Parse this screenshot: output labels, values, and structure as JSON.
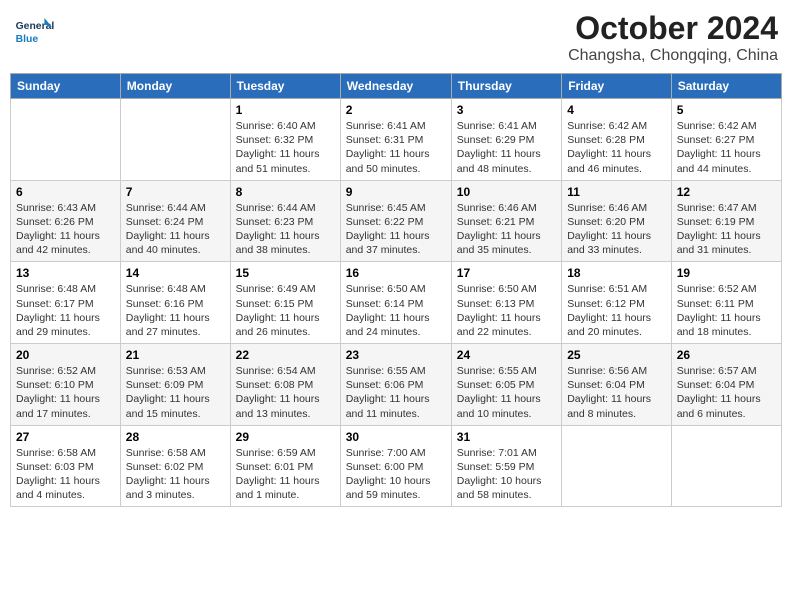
{
  "header": {
    "logo_general": "General",
    "logo_blue": "Blue",
    "title": "October 2024",
    "subtitle": "Changsha, Chongqing, China"
  },
  "calendar": {
    "days_of_week": [
      "Sunday",
      "Monday",
      "Tuesday",
      "Wednesday",
      "Thursday",
      "Friday",
      "Saturday"
    ],
    "weeks": [
      [
        {
          "day": "",
          "sunrise": "",
          "sunset": "",
          "daylight": ""
        },
        {
          "day": "",
          "sunrise": "",
          "sunset": "",
          "daylight": ""
        },
        {
          "day": "1",
          "sunrise": "Sunrise: 6:40 AM",
          "sunset": "Sunset: 6:32 PM",
          "daylight": "Daylight: 11 hours and 51 minutes."
        },
        {
          "day": "2",
          "sunrise": "Sunrise: 6:41 AM",
          "sunset": "Sunset: 6:31 PM",
          "daylight": "Daylight: 11 hours and 50 minutes."
        },
        {
          "day": "3",
          "sunrise": "Sunrise: 6:41 AM",
          "sunset": "Sunset: 6:29 PM",
          "daylight": "Daylight: 11 hours and 48 minutes."
        },
        {
          "day": "4",
          "sunrise": "Sunrise: 6:42 AM",
          "sunset": "Sunset: 6:28 PM",
          "daylight": "Daylight: 11 hours and 46 minutes."
        },
        {
          "day": "5",
          "sunrise": "Sunrise: 6:42 AM",
          "sunset": "Sunset: 6:27 PM",
          "daylight": "Daylight: 11 hours and 44 minutes."
        }
      ],
      [
        {
          "day": "6",
          "sunrise": "Sunrise: 6:43 AM",
          "sunset": "Sunset: 6:26 PM",
          "daylight": "Daylight: 11 hours and 42 minutes."
        },
        {
          "day": "7",
          "sunrise": "Sunrise: 6:44 AM",
          "sunset": "Sunset: 6:24 PM",
          "daylight": "Daylight: 11 hours and 40 minutes."
        },
        {
          "day": "8",
          "sunrise": "Sunrise: 6:44 AM",
          "sunset": "Sunset: 6:23 PM",
          "daylight": "Daylight: 11 hours and 38 minutes."
        },
        {
          "day": "9",
          "sunrise": "Sunrise: 6:45 AM",
          "sunset": "Sunset: 6:22 PM",
          "daylight": "Daylight: 11 hours and 37 minutes."
        },
        {
          "day": "10",
          "sunrise": "Sunrise: 6:46 AM",
          "sunset": "Sunset: 6:21 PM",
          "daylight": "Daylight: 11 hours and 35 minutes."
        },
        {
          "day": "11",
          "sunrise": "Sunrise: 6:46 AM",
          "sunset": "Sunset: 6:20 PM",
          "daylight": "Daylight: 11 hours and 33 minutes."
        },
        {
          "day": "12",
          "sunrise": "Sunrise: 6:47 AM",
          "sunset": "Sunset: 6:19 PM",
          "daylight": "Daylight: 11 hours and 31 minutes."
        }
      ],
      [
        {
          "day": "13",
          "sunrise": "Sunrise: 6:48 AM",
          "sunset": "Sunset: 6:17 PM",
          "daylight": "Daylight: 11 hours and 29 minutes."
        },
        {
          "day": "14",
          "sunrise": "Sunrise: 6:48 AM",
          "sunset": "Sunset: 6:16 PM",
          "daylight": "Daylight: 11 hours and 27 minutes."
        },
        {
          "day": "15",
          "sunrise": "Sunrise: 6:49 AM",
          "sunset": "Sunset: 6:15 PM",
          "daylight": "Daylight: 11 hours and 26 minutes."
        },
        {
          "day": "16",
          "sunrise": "Sunrise: 6:50 AM",
          "sunset": "Sunset: 6:14 PM",
          "daylight": "Daylight: 11 hours and 24 minutes."
        },
        {
          "day": "17",
          "sunrise": "Sunrise: 6:50 AM",
          "sunset": "Sunset: 6:13 PM",
          "daylight": "Daylight: 11 hours and 22 minutes."
        },
        {
          "day": "18",
          "sunrise": "Sunrise: 6:51 AM",
          "sunset": "Sunset: 6:12 PM",
          "daylight": "Daylight: 11 hours and 20 minutes."
        },
        {
          "day": "19",
          "sunrise": "Sunrise: 6:52 AM",
          "sunset": "Sunset: 6:11 PM",
          "daylight": "Daylight: 11 hours and 18 minutes."
        }
      ],
      [
        {
          "day": "20",
          "sunrise": "Sunrise: 6:52 AM",
          "sunset": "Sunset: 6:10 PM",
          "daylight": "Daylight: 11 hours and 17 minutes."
        },
        {
          "day": "21",
          "sunrise": "Sunrise: 6:53 AM",
          "sunset": "Sunset: 6:09 PM",
          "daylight": "Daylight: 11 hours and 15 minutes."
        },
        {
          "day": "22",
          "sunrise": "Sunrise: 6:54 AM",
          "sunset": "Sunset: 6:08 PM",
          "daylight": "Daylight: 11 hours and 13 minutes."
        },
        {
          "day": "23",
          "sunrise": "Sunrise: 6:55 AM",
          "sunset": "Sunset: 6:06 PM",
          "daylight": "Daylight: 11 hours and 11 minutes."
        },
        {
          "day": "24",
          "sunrise": "Sunrise: 6:55 AM",
          "sunset": "Sunset: 6:05 PM",
          "daylight": "Daylight: 11 hours and 10 minutes."
        },
        {
          "day": "25",
          "sunrise": "Sunrise: 6:56 AM",
          "sunset": "Sunset: 6:04 PM",
          "daylight": "Daylight: 11 hours and 8 minutes."
        },
        {
          "day": "26",
          "sunrise": "Sunrise: 6:57 AM",
          "sunset": "Sunset: 6:04 PM",
          "daylight": "Daylight: 11 hours and 6 minutes."
        }
      ],
      [
        {
          "day": "27",
          "sunrise": "Sunrise: 6:58 AM",
          "sunset": "Sunset: 6:03 PM",
          "daylight": "Daylight: 11 hours and 4 minutes."
        },
        {
          "day": "28",
          "sunrise": "Sunrise: 6:58 AM",
          "sunset": "Sunset: 6:02 PM",
          "daylight": "Daylight: 11 hours and 3 minutes."
        },
        {
          "day": "29",
          "sunrise": "Sunrise: 6:59 AM",
          "sunset": "Sunset: 6:01 PM",
          "daylight": "Daylight: 11 hours and 1 minute."
        },
        {
          "day": "30",
          "sunrise": "Sunrise: 7:00 AM",
          "sunset": "Sunset: 6:00 PM",
          "daylight": "Daylight: 10 hours and 59 minutes."
        },
        {
          "day": "31",
          "sunrise": "Sunrise: 7:01 AM",
          "sunset": "Sunset: 5:59 PM",
          "daylight": "Daylight: 10 hours and 58 minutes."
        },
        {
          "day": "",
          "sunrise": "",
          "sunset": "",
          "daylight": ""
        },
        {
          "day": "",
          "sunrise": "",
          "sunset": "",
          "daylight": ""
        }
      ]
    ]
  }
}
